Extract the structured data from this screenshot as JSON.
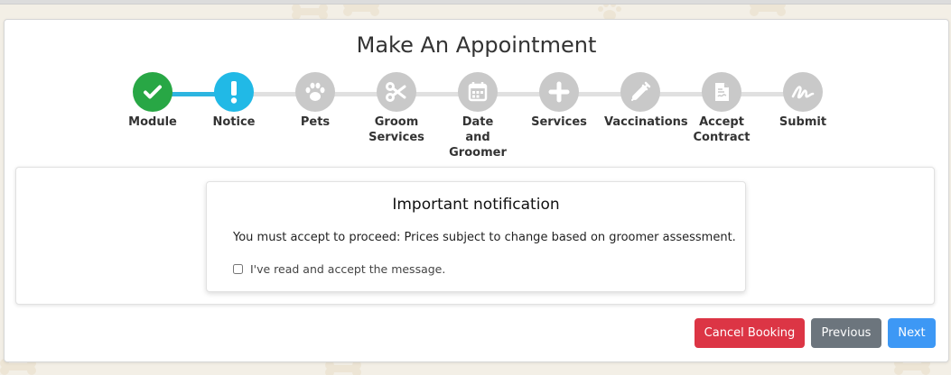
{
  "page": {
    "title": "Make An Appointment"
  },
  "steps": [
    {
      "label": "Module",
      "state": "done",
      "icon": "check-icon"
    },
    {
      "label": "Notice",
      "state": "active",
      "icon": "exclamation-icon"
    },
    {
      "label": "Pets",
      "state": "pending",
      "icon": "paw-icon"
    },
    {
      "label": "Groom Services",
      "state": "pending",
      "icon": "scissors-icon"
    },
    {
      "label": "Date and Groomer",
      "state": "pending",
      "icon": "calendar-icon"
    },
    {
      "label": "Services",
      "state": "pending",
      "icon": "plus-icon"
    },
    {
      "label": "Vaccinations",
      "state": "pending",
      "icon": "syringe-icon"
    },
    {
      "label": "Accept Contract",
      "state": "pending",
      "icon": "contract-icon"
    },
    {
      "label": "Submit",
      "state": "pending",
      "icon": "signature-icon"
    }
  ],
  "notice": {
    "title": "Important notification",
    "message": "You must accept to proceed: Prices subject to change based on groomer assessment.",
    "checkbox_label": "I've read and accept the message.",
    "checked": false
  },
  "buttons": {
    "cancel": "Cancel Booking",
    "previous": "Previous",
    "next": "Next"
  },
  "colors": {
    "done": "#28a745",
    "active": "#21b9e6",
    "pending": "#c9c9c9",
    "cancel": "#dc3545",
    "previous": "#6c757d",
    "next": "#3d98f5"
  }
}
